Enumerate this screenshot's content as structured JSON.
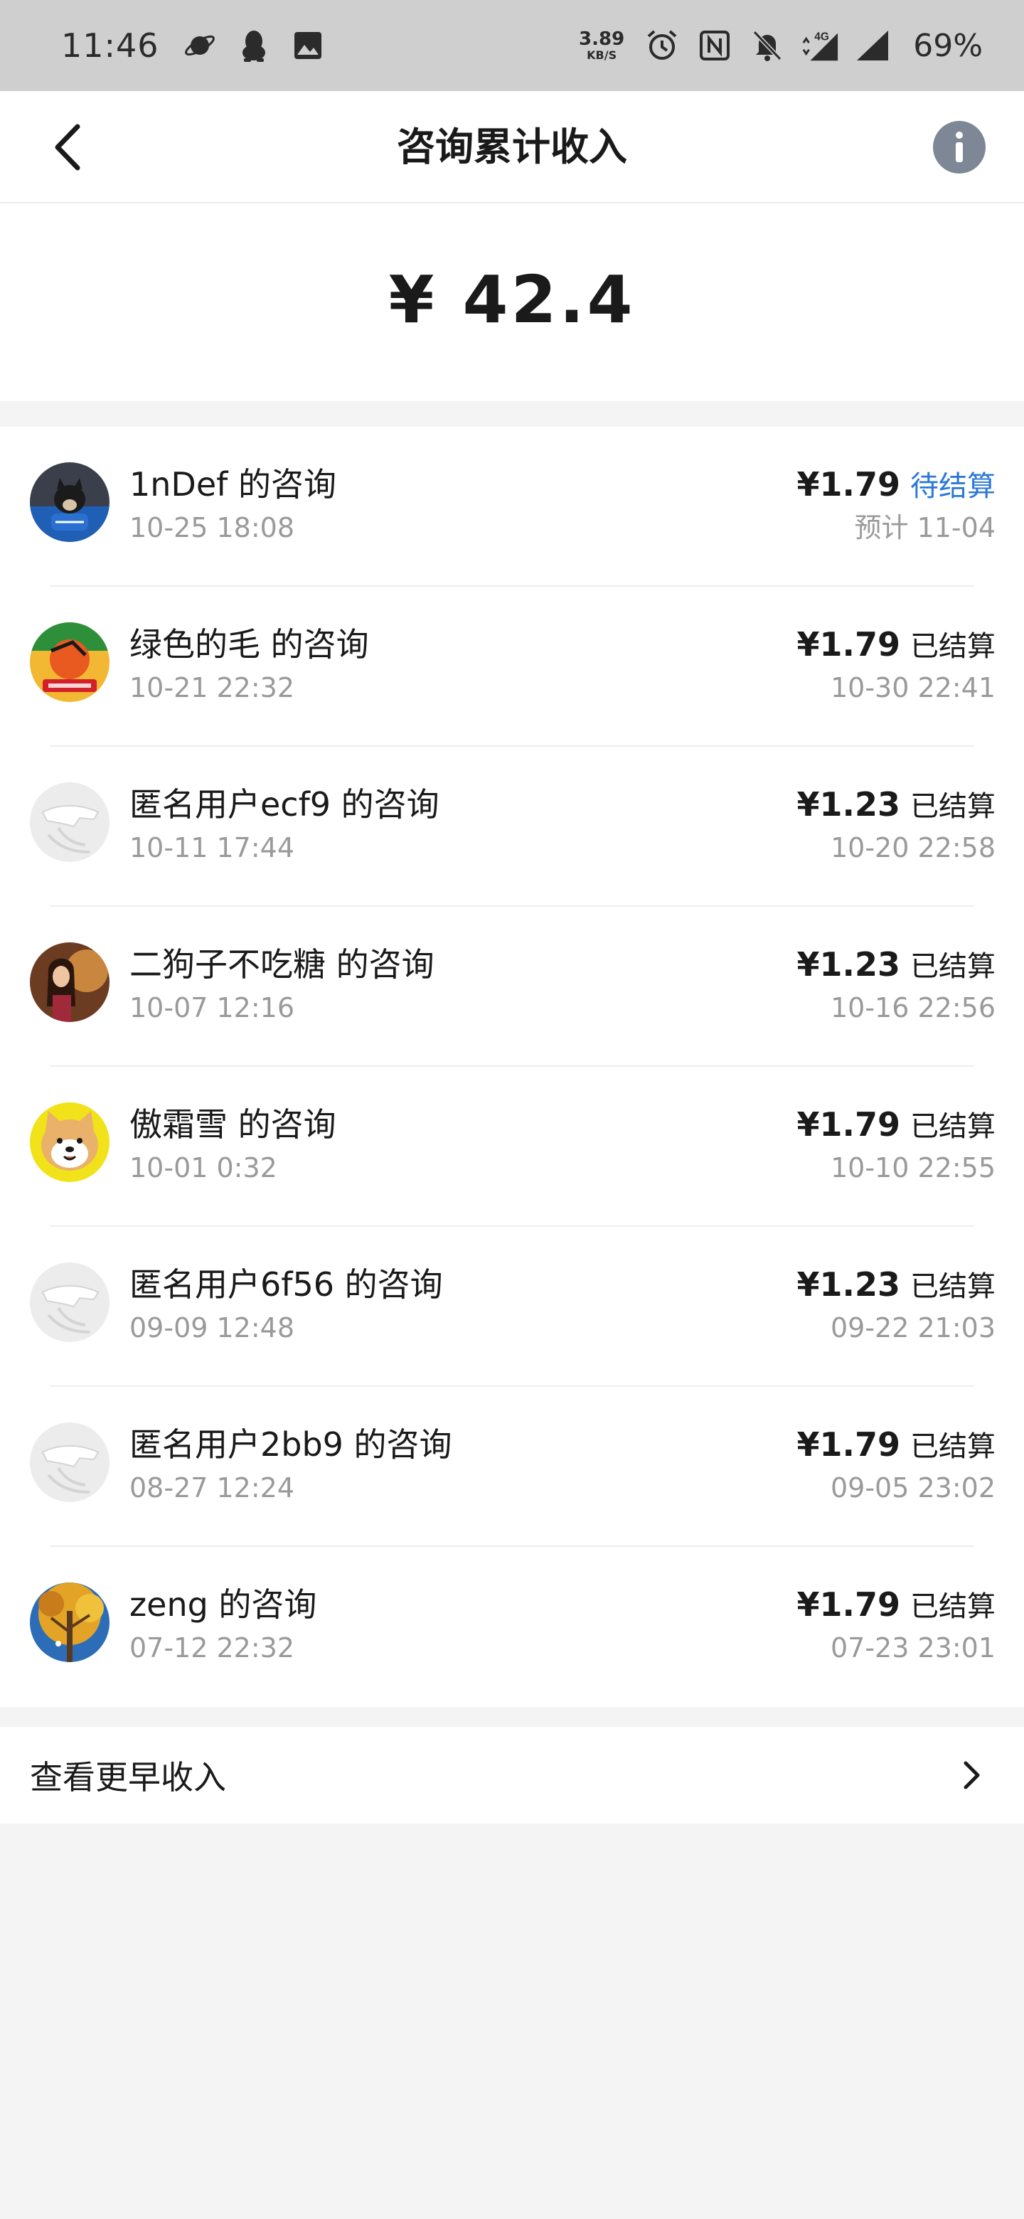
{
  "status_bar": {
    "time": "11:46",
    "speed_value": "3.89",
    "speed_unit": "KB/S",
    "network": "4G",
    "battery": "69%",
    "icons": [
      "planet-icon",
      "qq-penguin-icon",
      "image-icon",
      "alarm-icon",
      "nfc-icon",
      "bell-off-icon",
      "signal-4g-icon",
      "signal-icon"
    ]
  },
  "header": {
    "title": "咨询累计收入",
    "back_icon": "back-chevron-icon",
    "info_icon": "info-icon"
  },
  "summary": {
    "total": "¥ 42.4"
  },
  "items": [
    {
      "name": "1nDef 的咨询",
      "time": "10-25 18:08",
      "amount": "¥1.79",
      "status": "待结算",
      "status_type": "pending",
      "detail": "预计 11-04",
      "avatar": "dog-photo-avatar"
    },
    {
      "name": "绿色的毛 的咨询",
      "time": "10-21 22:32",
      "amount": "¥1.79",
      "status": "已结算",
      "status_type": "settled",
      "detail": "10-30 22:41",
      "avatar": "colorful-photo-avatar"
    },
    {
      "name": "匿名用户ecf9 的咨询",
      "time": "10-11 17:44",
      "amount": "¥1.23",
      "status": "已结算",
      "status_type": "settled",
      "detail": "10-20 22:58",
      "avatar": "anonymous-avatar"
    },
    {
      "name": "二狗子不吃糖 的咨询",
      "time": "10-07 12:16",
      "amount": "¥1.23",
      "status": "已结算",
      "status_type": "settled",
      "detail": "10-16 22:56",
      "avatar": "portrait-photo-avatar"
    },
    {
      "name": "傲霜雪 的咨询",
      "time": "10-01 0:32",
      "amount": "¥1.79",
      "status": "已结算",
      "status_type": "settled",
      "detail": "10-10 22:55",
      "avatar": "shiba-photo-avatar"
    },
    {
      "name": "匿名用户6f56 的咨询",
      "time": "09-09 12:48",
      "amount": "¥1.23",
      "status": "已结算",
      "status_type": "settled",
      "detail": "09-22 21:03",
      "avatar": "anonymous-avatar"
    },
    {
      "name": "匿名用户2bb9 的咨询",
      "time": "08-27 12:24",
      "amount": "¥1.79",
      "status": "已结算",
      "status_type": "settled",
      "detail": "09-05 23:02",
      "avatar": "anonymous-avatar"
    },
    {
      "name": "zeng 的咨询",
      "time": "07-12 22:32",
      "amount": "¥1.79",
      "status": "已结算",
      "status_type": "settled",
      "detail": "07-23 23:01",
      "avatar": "autumn-tree-photo-avatar"
    }
  ],
  "more": {
    "label": "查看更早收入",
    "icon": "chevron-right-icon"
  },
  "colors": {
    "pending": "#2b78d6",
    "status_bar": "#cfcfcf",
    "background": "#f4f4f4"
  }
}
